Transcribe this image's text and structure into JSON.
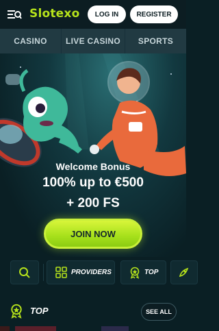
{
  "header": {
    "logo_text": "Slotexo",
    "login_label": "LOG IN",
    "register_label": "REGISTER"
  },
  "nav": {
    "tabs": [
      {
        "label": "CASINO"
      },
      {
        "label": "LIVE CASINO"
      },
      {
        "label": "SPORTS"
      }
    ]
  },
  "hero": {
    "subtitle": "Welcome Bonus",
    "line1": "100% up to €500",
    "line2": "+ 200 FS",
    "cta_label": "JOIN NOW"
  },
  "filters": {
    "providers_label": "PROVIDERS",
    "top_label": "TOP"
  },
  "section": {
    "title": "TOP",
    "see_all_label": "SEE ALL"
  },
  "colors": {
    "accent": "#b6e31b",
    "background": "#0a1f24",
    "nav_bg": "#213a42"
  }
}
